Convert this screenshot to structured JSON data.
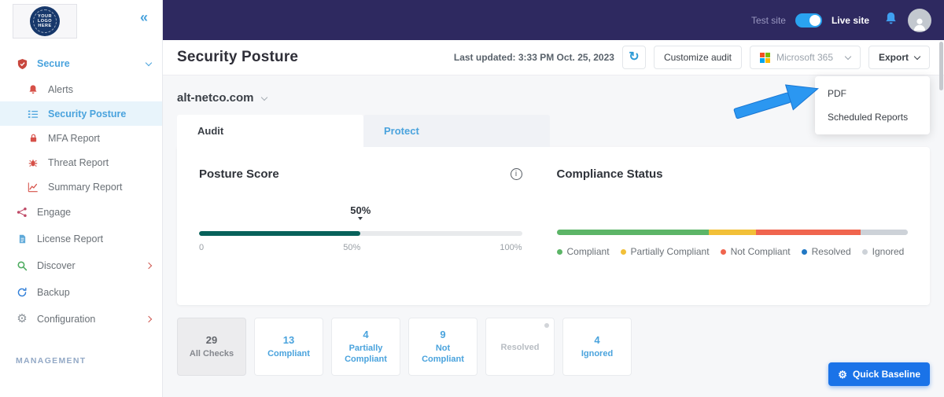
{
  "topbar": {
    "test_site": "Test site",
    "live_site": "Live site"
  },
  "sidebar": {
    "logo_lines": [
      "YOUR",
      "LOGO",
      "HERE"
    ],
    "management": "MANAGEMENT",
    "items": [
      {
        "label": "Secure"
      },
      {
        "label": "Alerts"
      },
      {
        "label": "Security Posture"
      },
      {
        "label": "MFA Report"
      },
      {
        "label": "Threat Report"
      },
      {
        "label": "Summary Report"
      },
      {
        "label": "Engage"
      },
      {
        "label": "License Report"
      },
      {
        "label": "Discover"
      },
      {
        "label": "Backup"
      },
      {
        "label": "Configuration"
      }
    ]
  },
  "header": {
    "title": "Security Posture",
    "last_updated": "Last updated: 3:33 PM Oct. 25, 2023",
    "customize_audit": "Customize audit",
    "tenant": "Microsoft 365",
    "export": "Export",
    "export_menu": [
      {
        "label": "PDF"
      },
      {
        "label": "Scheduled Reports"
      }
    ]
  },
  "main": {
    "domain": "alt-netco.com",
    "tabs": [
      {
        "label": "Audit"
      },
      {
        "label": "Protect"
      }
    ],
    "posture_title": "Posture Score",
    "posture_value": "50%",
    "compliance_title": "Compliance Status",
    "stats": [
      {
        "value": "29",
        "label": "All Checks"
      },
      {
        "value": "13",
        "label": "Compliant"
      },
      {
        "value": "4",
        "label": "Partially Compliant"
      },
      {
        "value": "9",
        "label": "Not Compliant"
      },
      {
        "value": "",
        "label": "Resolved"
      },
      {
        "value": "4",
        "label": "Ignored"
      }
    ],
    "quick_baseline": "Quick Baseline"
  },
  "chart_data": [
    {
      "type": "bar",
      "title": "Posture Score",
      "value": 50,
      "max": 100,
      "ticks": [
        "0",
        "50%",
        "100%"
      ]
    },
    {
      "type": "bar",
      "title": "Compliance Status",
      "stacked": true,
      "segments": [
        {
          "label": "Compliant",
          "value": 13,
          "color": "#5cb567"
        },
        {
          "label": "Partially Compliant",
          "value": 4,
          "color": "#f2c038"
        },
        {
          "label": "Not Compliant",
          "value": 9,
          "color": "#f0654e"
        },
        {
          "label": "Resolved",
          "value": 0,
          "color": "#2178c4"
        },
        {
          "label": "Ignored",
          "value": 4,
          "color": "#cdd2d8"
        }
      ]
    }
  ],
  "colors": {
    "accent_blue": "#4aa3dd",
    "topbar_bg": "#2e2960",
    "posture_fill": "#07615a",
    "primary_button": "#1a73e8"
  }
}
